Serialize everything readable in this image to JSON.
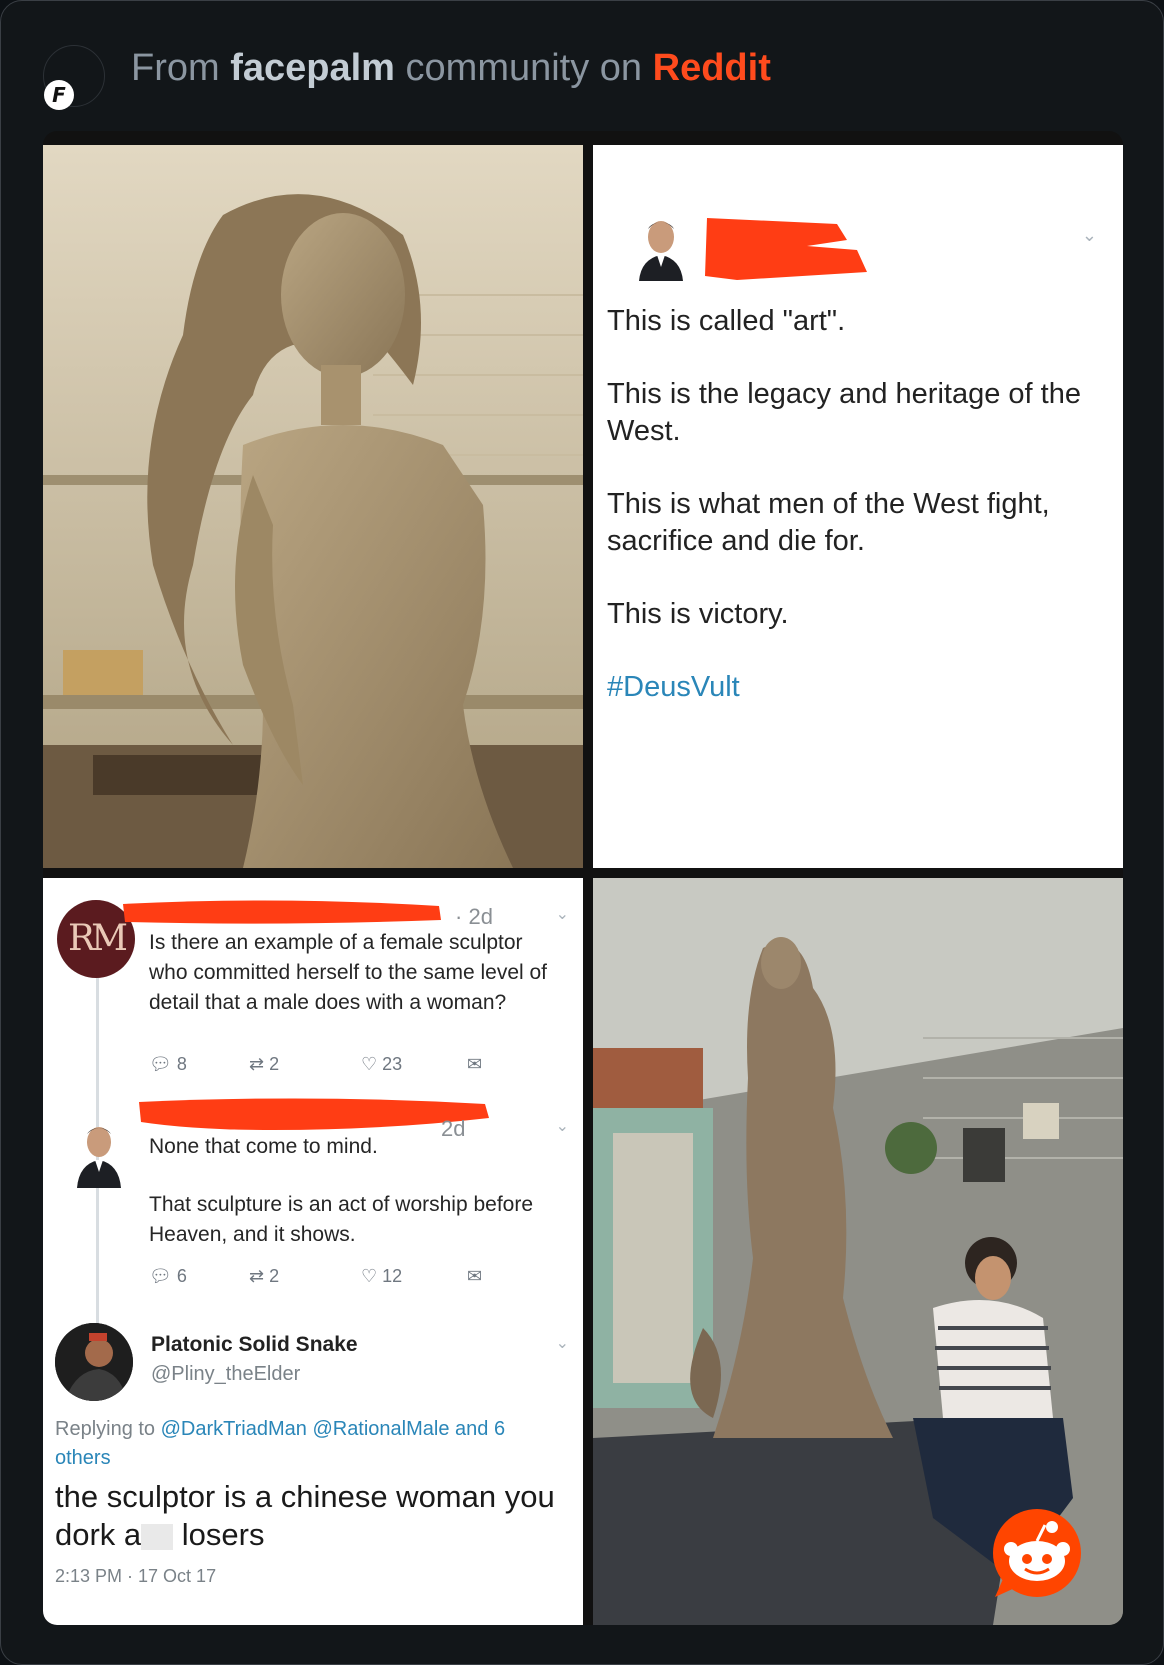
{
  "header": {
    "prefix": "From",
    "subreddit": "facepalm",
    "middle": "community on",
    "site": "Reddit",
    "badge_letter": "F"
  },
  "tweet_top": {
    "lines": [
      "This is called \"art\".",
      "This is the legacy and heritage of the West.",
      "This is what men of the West fight, sacrifice and die for.",
      "This is victory."
    ],
    "hashtag": "#DeusVult"
  },
  "thread": {
    "rm_initials": "RM",
    "first": {
      "age": "2d",
      "text": "Is there an example of a female sculptor who committed herself to the same level of detail that a male does with a woman?",
      "replies": "8",
      "retweets": "2",
      "likes": "23"
    },
    "second": {
      "age": "2d",
      "text1": "None that come to mind.",
      "text2": "That sculpture is an act of worship before Heaven, and it shows.",
      "replies": "6",
      "retweets": "2",
      "likes": "12"
    },
    "third": {
      "name": "Platonic Solid Snake",
      "handle": "@Pliny_theElder",
      "replying_prefix": "Replying to",
      "replying_links": "@DarkTriadMan @RationalMale and 6 others",
      "reply_part1": "the sculptor is a chinese woman you dork a",
      "reply_part2": "losers",
      "timestamp": "2:13 PM · 17 Oct 17"
    }
  },
  "colors": {
    "reddit_orange": "#ff4b1d",
    "link_blue": "#2a86b8",
    "redaction": "#ff3d14"
  }
}
